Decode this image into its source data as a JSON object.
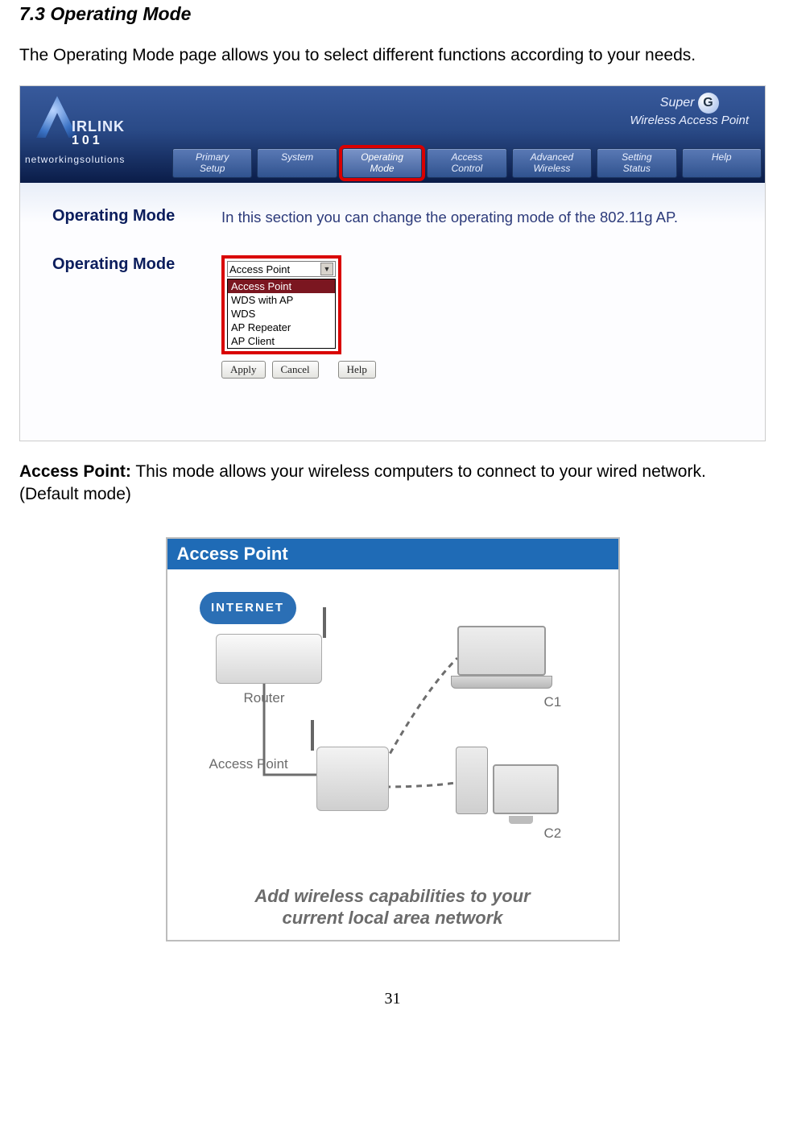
{
  "section_heading": "7.3 Operating Mode",
  "intro_text": "The Operating Mode page allows you to select different functions according to your needs.",
  "ui": {
    "brand_main": "IRLINK",
    "brand_sub": "101",
    "brand_tagline": "networkingsolutions",
    "product_line1": "Super",
    "product_line2": "Wireless Access Point",
    "nav": [
      {
        "line1": "Primary",
        "line2": "Setup"
      },
      {
        "line1": "System",
        "line2": ""
      },
      {
        "line1": "Operating",
        "line2": "Mode"
      },
      {
        "line1": "Access",
        "line2": "Control"
      },
      {
        "line1": "Advanced",
        "line2": "Wireless"
      },
      {
        "line1": "Setting",
        "line2": "Status"
      },
      {
        "line1": "Help",
        "line2": ""
      }
    ],
    "active_nav_index": 2,
    "row1_label": "Operating Mode",
    "row1_desc": "In this section you can change the operating mode of the 802.11g AP.",
    "row2_label": "Operating Mode",
    "select_current": "Access Point",
    "select_options": [
      "Access Point",
      "WDS with AP",
      "WDS",
      "AP Repeater",
      "AP Client"
    ],
    "selected_option_index": 0,
    "buttons": {
      "apply": "Apply",
      "cancel": "Cancel",
      "help": "Help"
    }
  },
  "ap_para_label": "Access Point:",
  "ap_para_text": " This mode allows your wireless computers to connect to your wired network. (Default mode)",
  "diagram": {
    "title": "Access Point",
    "internet": "INTERNET",
    "router": "Router",
    "ap": "Access Point",
    "c1": "C1",
    "c2": "C2",
    "caption_l1": "Add wireless capabilities to your",
    "caption_l2": "current local area network"
  },
  "page_number": "31"
}
